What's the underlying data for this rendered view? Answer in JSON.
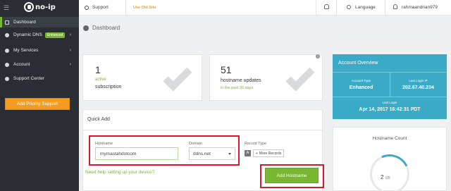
{
  "sidebar": {
    "items": [
      {
        "label": "Dashboard"
      },
      {
        "label": "Dynamic DNS",
        "badge": "Enhanced"
      },
      {
        "label": "My Services"
      },
      {
        "label": "Account"
      },
      {
        "label": "Support Center"
      }
    ],
    "priority_button": "Add Priority Support"
  },
  "topbar": {
    "support": "Support",
    "old_site": "Use Old Site",
    "language": "Language",
    "username": "rahmaandrian979"
  },
  "page_title": "Dashboard",
  "cards": {
    "subscription": {
      "number": "1",
      "status": "active",
      "label": "subscription"
    },
    "updates": {
      "number": "51",
      "label": "hostname updates",
      "period": "in the past 30 days"
    }
  },
  "quick_add": {
    "title": "Quick Add",
    "hostname_label": "Hostname",
    "hostname_value": "mymastahdotcom",
    "domain_label": "Domain",
    "domain_value": "ddns.net",
    "record_type_label": "Record Type",
    "record_type_value": "A",
    "more_records": "More Records",
    "help_link": "Need help setting up your device?",
    "add_button": "Add Hostname"
  },
  "account_overview": {
    "title": "Account Overview",
    "account_type_label": "Account Type",
    "account_type_value": "Enhanced",
    "last_login_ip_label": "Last Login IP",
    "last_login_ip_value": "202.67.40.234",
    "last_login_label": "Last Login",
    "last_login_value": "Apr 14, 2017 16:42:31 PDT"
  },
  "hostname_count": {
    "title": "Hostname Count",
    "used": "2",
    "total": "/25"
  },
  "colors": {
    "accent_green": "#7ab632",
    "accent_blue": "#3aaac6",
    "orange": "#f39c1f",
    "highlight_red": "#d6192b"
  }
}
